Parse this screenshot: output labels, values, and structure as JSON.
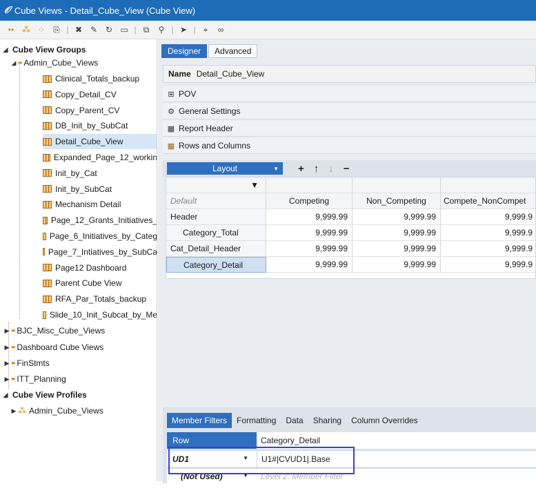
{
  "window": {
    "title": "Cube Views - Detail_Cube_View (Cube View)"
  },
  "tree": {
    "groups_header": "Cube View Groups",
    "admin_group": "Admin_Cube_Views",
    "items": [
      "Clinical_Totals_backup",
      "Copy_Detail_CV",
      "Copy_Parent_CV",
      "DB_Init_by_SubCat",
      "Detail_Cube_View",
      "Expanded_Page_12_workin",
      "Init_by_Cat",
      "Init_by_SubCat",
      "Mechanism Detail",
      "Page_12_Grants_Initiatives_",
      "Page_6_Initiatives_by_Categ",
      "Page_7_Intiatives_by_SubCa",
      "Page12 Dashboard",
      "Parent Cube View",
      "RFA_Par_Totals_backup",
      "Slide_10_Init_Subcat_by_Me"
    ],
    "selected_item": "Detail_Cube_View",
    "other_groups": [
      "BJC_Misc_Cube_Views",
      "Dashboard Cube Views",
      "FinStmts",
      "ITT_Planning"
    ],
    "profiles_header": "Cube View Profiles",
    "profiles": [
      "Admin_Cube_Views"
    ]
  },
  "tabs": {
    "designer": "Designer",
    "advanced": "Advanced"
  },
  "name_row": {
    "label": "Name",
    "value": "Detail_Cube_View"
  },
  "sections": {
    "pov": "POV",
    "general": "General Settings",
    "report_header": "Report Header",
    "rows_columns": "Rows and Columns"
  },
  "layout": {
    "label": "Layout"
  },
  "grid": {
    "columns": [
      "Competing",
      "Non_Competing",
      "Compete_NonCompet"
    ],
    "default_label": "Default",
    "rows": [
      {
        "label": "Header",
        "values": [
          "9,999.99",
          "9,999.99",
          "9,999.9"
        ]
      },
      {
        "label": "Category_Total",
        "values": [
          "9,999.99",
          "9,999.99",
          "9,999.9"
        ]
      },
      {
        "label": "Cat_Detail_Header",
        "values": [
          "9,999.99",
          "9,999.99",
          "9,999.9"
        ]
      },
      {
        "label": "Category_Detail",
        "values": [
          "9,999.99",
          "9,999.99",
          "9,999.9"
        ]
      }
    ]
  },
  "bottom": {
    "tabs": [
      "Member Filters",
      "Formatting",
      "Data",
      "Sharing",
      "Column Overrides"
    ],
    "row_label": "Row",
    "row_value": "Category_Detail",
    "ud_label": "UD1",
    "ud_value": "U1#|CVUD1|.Base",
    "not_used_label": "(Not Used)",
    "level2_placeholder": "Level 2: Member Filter"
  },
  "colors": {
    "accent": "#2e6fc0",
    "titlebar": "#1e6bb8",
    "highlight": "#3a3fd6",
    "orange": "#e08a00"
  }
}
